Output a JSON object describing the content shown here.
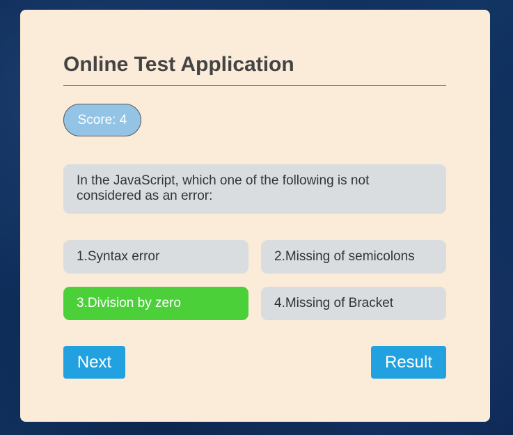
{
  "app": {
    "title": "Online Test Application"
  },
  "score": {
    "label": "Score: 4"
  },
  "question": {
    "text": "In the JavaScript, which one of the following is not considered as an error:"
  },
  "options": [
    {
      "label": "1.Syntax error",
      "selected": false
    },
    {
      "label": "2.Missing of semicolons",
      "selected": false
    },
    {
      "label": "3.Division by zero",
      "selected": true
    },
    {
      "label": "4.Missing of Bracket",
      "selected": false
    }
  ],
  "buttons": {
    "next_label": "Next",
    "result_label": "Result"
  },
  "colors": {
    "card_background": "#fbebd9",
    "score_badge": "#93c4e6",
    "option_default": "#dadde0",
    "option_selected": "#4cd03a",
    "button": "#21a1df"
  }
}
